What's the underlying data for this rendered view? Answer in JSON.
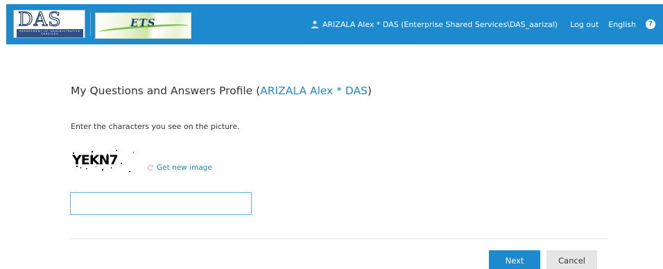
{
  "header": {
    "das_logo_text": "DAS",
    "das_logo_sub": "DEPARTMENT OF ADMINISTRATIVE SERVICES",
    "ets_logo_text": "ETS",
    "user_name": "ARIZALA Alex * DAS (Enterprise Shared Services\\DAS_aarizal)",
    "logout_label": "Log out",
    "language_label": "English",
    "help_label": "?"
  },
  "main": {
    "title": "My Questions and Answers Profile (",
    "title_user": "ARIZALA Alex * DAS",
    "title_close": ")",
    "instruction": "Enter the characters you see on the picture.",
    "captcha_text": "YEKN7",
    "new_image_label": "Get new image",
    "captcha_input_value": ""
  },
  "buttons": {
    "next_label": "Next",
    "cancel_label": "Cancel"
  },
  "colors": {
    "brand_blue": "#1d8ad0",
    "cancel_gray": "#e6e6e6"
  },
  "icons": {
    "user": "user-icon",
    "help": "help-icon",
    "refresh": "refresh-icon"
  }
}
